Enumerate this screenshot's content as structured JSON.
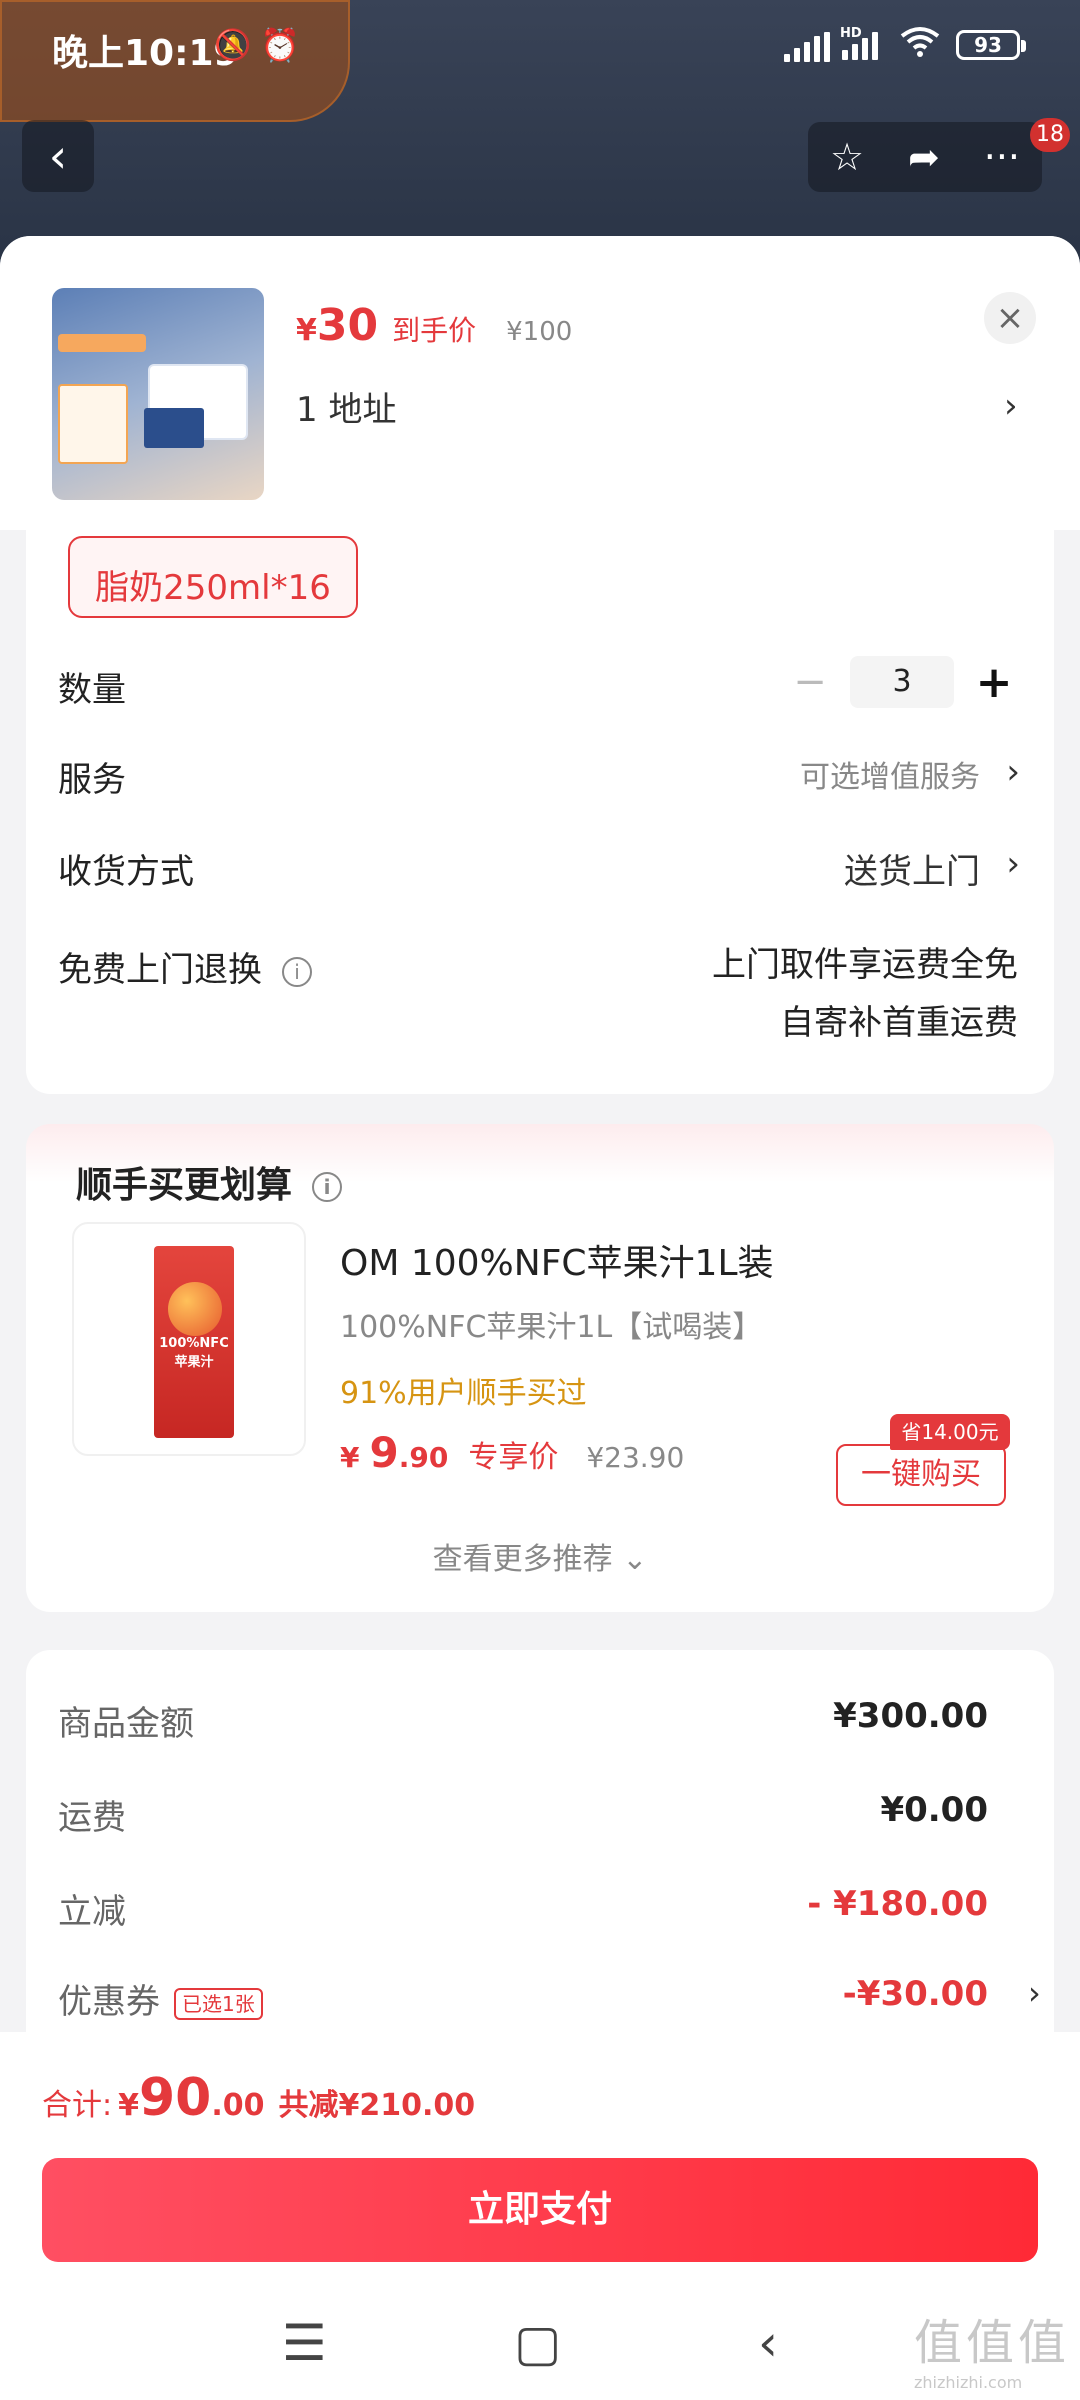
{
  "status": {
    "time": "晚上10:19",
    "battery": "93",
    "signal_label": "HD",
    "bell_icon": "🔕",
    "alarm_icon": "⏰"
  },
  "topnav": {
    "back_icon": "‹",
    "star_icon": "☆",
    "share_icon": "➦",
    "more_icon": "···",
    "badge": "18"
  },
  "product_header": {
    "price_symbol": "¥",
    "price": "30",
    "price_tag": "到手价",
    "original_price": "¥100",
    "address": "1  地址",
    "address_arrow": "›",
    "close_icon": "×"
  },
  "options": {
    "spec_chip": "脂奶250ml*16",
    "quantity_label": "数量",
    "quantity_value": "3",
    "minus": "−",
    "plus": "+",
    "service_label": "服务",
    "service_value": "可选增值服务",
    "delivery_label": "收货方式",
    "delivery_value": "送货上门",
    "return_label": "免费上门退换",
    "return_line1": "上门取件享运费全免",
    "return_line2": "自寄补首重运费",
    "arrow": "›",
    "info_icon": "i"
  },
  "addon": {
    "title": "顺手买更划算",
    "info_icon": "i",
    "product_name": "OM 100%NFC苹果汁1L装",
    "product_sub": "100%NFC苹果汁1L【试喝装】",
    "bought": "91%用户顺手买过",
    "price_symbol": "¥",
    "price_int": "9",
    "price_dec": ".90",
    "price_tag": "专享价",
    "old_price": "¥23.90",
    "save_badge": "省14.00元",
    "buy_button": "一键购买",
    "carton_text": "100%NFC\n苹果汁",
    "more": "查看更多推荐 ⌄"
  },
  "summary": {
    "goods_label": "商品金额",
    "goods_value": "¥300.00",
    "shipping_label": "运费",
    "shipping_value": "¥0.00",
    "discount_label": "立减",
    "discount_value": "- ¥180.00",
    "coupon_label": "优惠券",
    "coupon_chip": "已选1张",
    "coupon_value": "-¥30.00",
    "arrow": "›"
  },
  "bottom": {
    "total_label": "合计:",
    "total_symbol": "¥",
    "total_int": "90",
    "total_dec": ".00",
    "total_saved": "共减¥210.00",
    "pay_button": "立即支付"
  },
  "navbar": {
    "menu_icon": "☰",
    "home_icon": "▢",
    "back_icon": "‹"
  },
  "watermark": {
    "big": "值值值",
    "small": "zhizhizhi.com"
  }
}
